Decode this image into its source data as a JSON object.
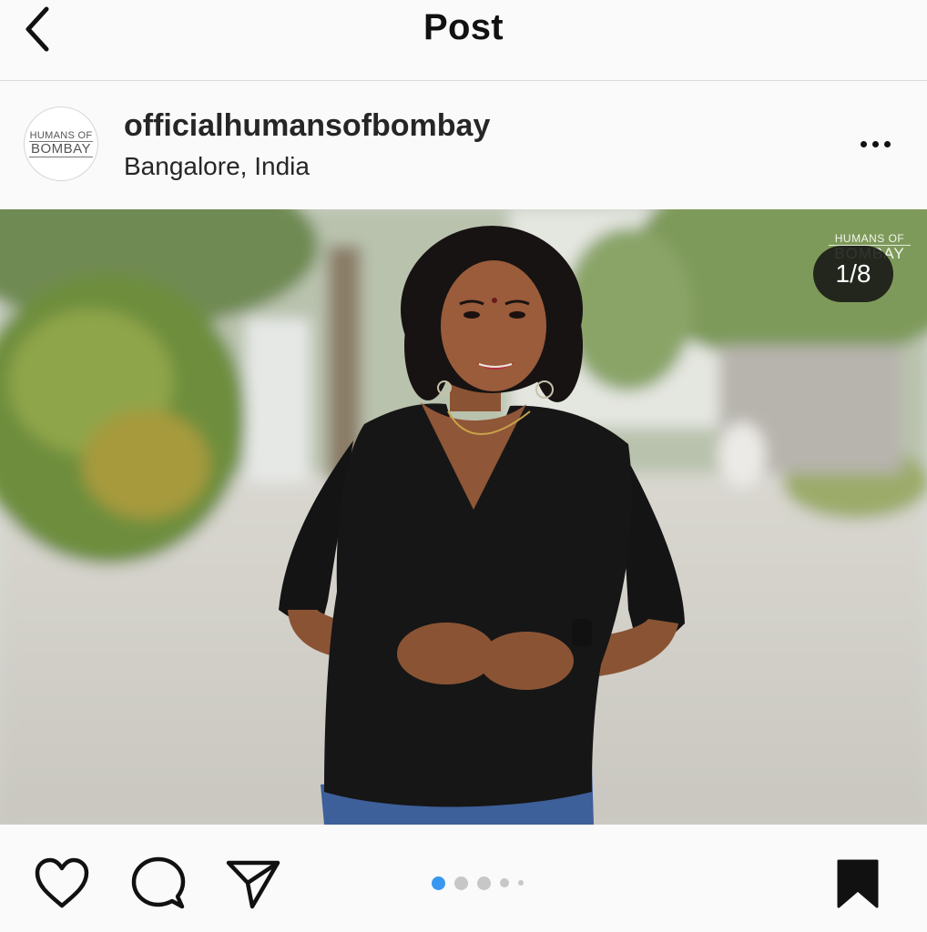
{
  "header": {
    "title": "Post",
    "back_icon": "chevron-left-icon"
  },
  "post": {
    "avatar_text_line1": "HUMANS OF",
    "avatar_text_line2": "BOMBAY",
    "username": "officialhumansofbombay",
    "location": "Bangalore, India",
    "more_icon": "more-horizontal-icon"
  },
  "media": {
    "watermark_line1": "HUMANS OF",
    "watermark_line2": "BOMBAY",
    "counter": "1/8",
    "current_index": 1,
    "total_count": 8
  },
  "actions": {
    "like_icon": "heart-icon",
    "comment_icon": "comment-icon",
    "share_icon": "paper-plane-icon",
    "save_icon": "bookmark-icon",
    "save_state": "saved"
  },
  "colors": {
    "active_dot": "#3897f0",
    "inactive_dot": "#c7c7c7",
    "text": "#262626",
    "background": "#fafafa"
  }
}
